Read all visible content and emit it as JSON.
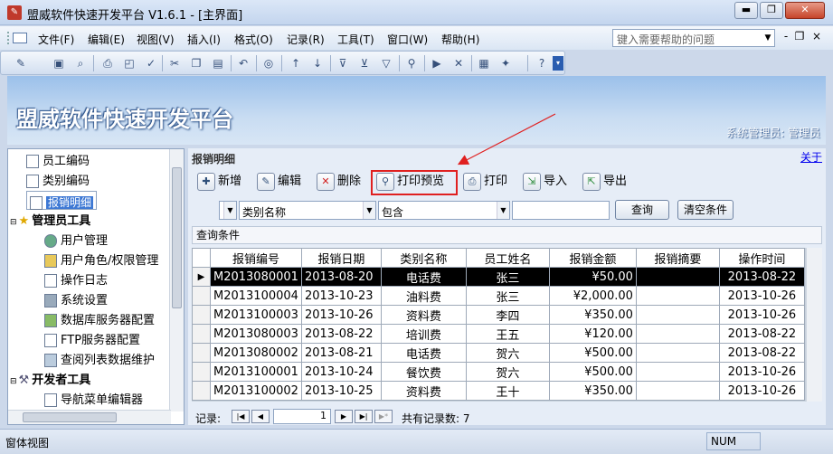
{
  "window": {
    "title": "盟威软件快速开发平台 V1.6.1 - [主界面]",
    "min": "▬",
    "max": "❐",
    "close": "✕"
  },
  "menubar": {
    "items": [
      "文件(F)",
      "编辑(E)",
      "视图(V)",
      "插入(I)",
      "格式(O)",
      "记录(R)",
      "工具(T)",
      "窗口(W)",
      "帮助(H)"
    ],
    "help_placeholder": "键入需要帮助的问题",
    "mdi": [
      "-",
      "❐",
      "×"
    ]
  },
  "banner": {
    "title": "盟威软件快速开发平台",
    "user": "系统管理员: 管理员"
  },
  "nav": {
    "items": [
      {
        "label": "员工编码",
        "kind": "leaf"
      },
      {
        "label": "类别编码",
        "kind": "leaf"
      },
      {
        "label": "报销明细",
        "kind": "leaf",
        "selected": true
      },
      {
        "label": "管理员工具",
        "kind": "group"
      },
      {
        "label": "用户管理",
        "kind": "sub"
      },
      {
        "label": "用户角色/权限管理",
        "kind": "sub"
      },
      {
        "label": "操作日志",
        "kind": "sub"
      },
      {
        "label": "系统设置",
        "kind": "sub"
      },
      {
        "label": "数据库服务器配置",
        "kind": "sub"
      },
      {
        "label": "FTP服务器配置",
        "kind": "sub"
      },
      {
        "label": "查阅列表数据维护",
        "kind": "sub"
      },
      {
        "label": "开发者工具",
        "kind": "group"
      },
      {
        "label": "导航菜单编辑器",
        "kind": "sub"
      }
    ]
  },
  "main": {
    "title": "报销明细",
    "close": "关于",
    "actions": [
      "新增",
      "编辑",
      "删除",
      "打印预览",
      "打印",
      "导入",
      "导出"
    ],
    "filter": {
      "field": "类别名称",
      "op": "包含",
      "value": "",
      "query_btn": "查询",
      "clear_btn": "清空条件"
    },
    "condition_label": "查询条件",
    "columns": [
      "报销编号",
      "报销日期",
      "类别名称",
      "员工姓名",
      "报销金额",
      "报销摘要",
      "操作时间"
    ],
    "rows": [
      [
        "M2013080001",
        "2013-08-20",
        "电话费",
        "张三",
        "¥50.00",
        "",
        "2013-08-22"
      ],
      [
        "M2013100004",
        "2013-10-23",
        "油料费",
        "张三",
        "¥2,000.00",
        "",
        "2013-10-26"
      ],
      [
        "M2013100003",
        "2013-10-26",
        "资料费",
        "李四",
        "¥350.00",
        "",
        "2013-10-26"
      ],
      [
        "M2013080003",
        "2013-08-22",
        "培训费",
        "王五",
        "¥120.00",
        "",
        "2013-08-22"
      ],
      [
        "M2013080002",
        "2013-08-21",
        "电话费",
        "贺六",
        "¥500.00",
        "",
        "2013-08-22"
      ],
      [
        "M2013100001",
        "2013-10-24",
        "餐饮费",
        "贺六",
        "¥500.00",
        "",
        "2013-10-26"
      ],
      [
        "M2013100002",
        "2013-10-25",
        "资料费",
        "王十",
        "¥350.00",
        "",
        "2013-10-26"
      ]
    ],
    "record_nav": {
      "label": "记录:",
      "current": "1",
      "total_label": "共有记录数: 7"
    }
  },
  "status": {
    "left": "窗体视图",
    "num": "NUM"
  },
  "colors": {
    "highlight": "#e02020",
    "selected_nav": "#3d78d4",
    "banner_top": "#9bc0ea"
  }
}
